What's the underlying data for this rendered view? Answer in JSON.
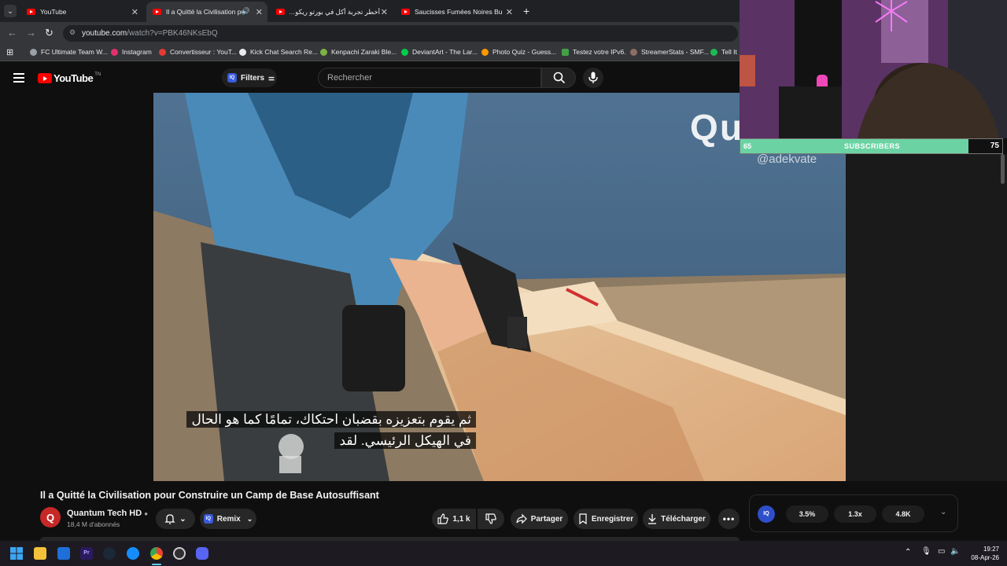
{
  "browser": {
    "tabs": [
      {
        "label": "YouTube",
        "active": false
      },
      {
        "label": "Il a Quitté la Civilisation po",
        "active": true
      },
      {
        "label": "أخطر تجربة أكل في بورتو ريكو…",
        "active": false
      },
      {
        "label": "Saucisses Fumées Noires Bushi",
        "active": false
      }
    ],
    "new_tab": "+",
    "url_host": "youtube.com",
    "url_path": "/watch?v=PBK46NKsEbQ",
    "bookmarks": [
      {
        "label": "FC Ultimate Team W...",
        "color": "#9aa0a6"
      },
      {
        "label": "Instagram",
        "color": "#e1306c"
      },
      {
        "label": "Convertisseur : YouT...",
        "color": "#e53935"
      },
      {
        "label": "Kick Chat Search Re...",
        "color": "#e8eaed"
      },
      {
        "label": "Kenpachi Zaraki Ble...",
        "color": "#7cb342"
      },
      {
        "label": "DeviantArt - The Lar...",
        "color": "#05cc47"
      },
      {
        "label": "Photo Quiz - Guess...",
        "color": "#ff9800"
      },
      {
        "label": "Testez votre IPv6.",
        "color": "#43a047"
      },
      {
        "label": "StreamerStats - SMF...",
        "color": "#8d6e63"
      },
      {
        "label": "Tell It",
        "color": "#1db954"
      }
    ]
  },
  "youtube": {
    "logo": "YouTube",
    "logo_suffix": "TN",
    "filters_label": "Filters",
    "search_placeholder": "Rechercher"
  },
  "video": {
    "subtitle_line1": "ثم يقوم بتعزيزه بقضبان احتكاك، تمامًا كما هو الحال",
    "subtitle_line2": "في الهيكل الرئيسي.  لقد",
    "watermark_handle": "@adekvate",
    "title": "Il a Quitté la Civilisation pour Construire un Camp de Base Autosuffisant",
    "channel_name": "Quantum Tech HD",
    "channel_subs": "18,4 M d'abonnés",
    "remix_label": "Remix",
    "likes": "1,1 k",
    "share_label": "Partager",
    "save_label": "Enregistrer",
    "download_label": "Télécharger"
  },
  "stats_widget": {
    "values": [
      "3.5%",
      "1.3x",
      "4.8K"
    ]
  },
  "overlay": {
    "sub_current": "65",
    "sub_label": "SUBSCRIBERS",
    "sub_goal": "75",
    "progress": 0.87
  },
  "clock": {
    "time": "19:27",
    "date": "08-Apr-26"
  }
}
